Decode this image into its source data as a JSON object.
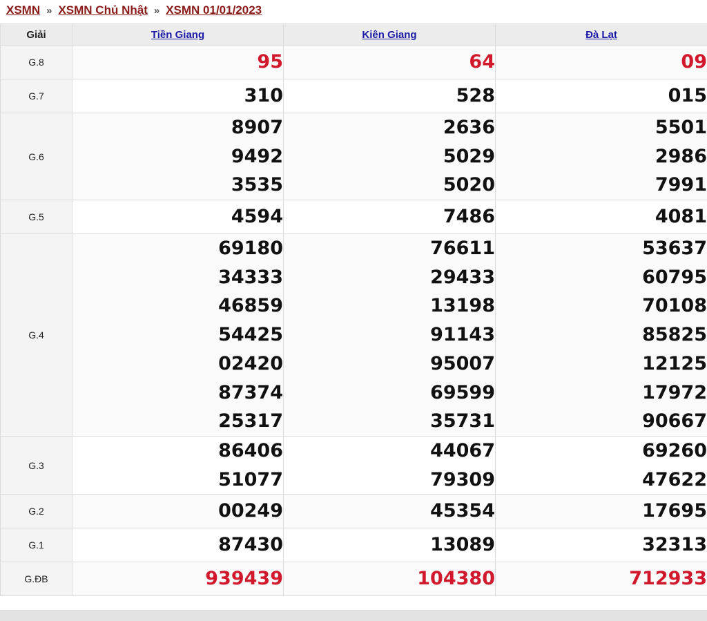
{
  "breadcrumb": {
    "item1": "XSMN",
    "item2": "XSMN Chủ Nhật",
    "item3": "XSMN 01/01/2023",
    "sep": "»"
  },
  "table": {
    "header": {
      "giai": "Giải",
      "col1": "Tiền Giang",
      "col2": "Kiên Giang",
      "col3": "Đà Lạt"
    },
    "rows": [
      {
        "label": "G.8",
        "c1": [
          "95"
        ],
        "c2": [
          "64"
        ],
        "c3": [
          "09"
        ]
      },
      {
        "label": "G.7",
        "c1": [
          "310"
        ],
        "c2": [
          "528"
        ],
        "c3": [
          "015"
        ]
      },
      {
        "label": "G.6",
        "c1": [
          "8907",
          "9492",
          "3535"
        ],
        "c2": [
          "2636",
          "5029",
          "5020"
        ],
        "c3": [
          "5501",
          "2986",
          "7991"
        ]
      },
      {
        "label": "G.5",
        "c1": [
          "4594"
        ],
        "c2": [
          "7486"
        ],
        "c3": [
          "4081"
        ]
      },
      {
        "label": "G.4",
        "c1": [
          "69180",
          "34333",
          "46859",
          "54425",
          "02420",
          "87374",
          "25317"
        ],
        "c2": [
          "76611",
          "29433",
          "13198",
          "91143",
          "95007",
          "69599",
          "35731"
        ],
        "c3": [
          "53637",
          "60795",
          "70108",
          "85825",
          "12125",
          "17972",
          "90667"
        ]
      },
      {
        "label": "G.3",
        "c1": [
          "86406",
          "51077"
        ],
        "c2": [
          "44067",
          "79309"
        ],
        "c3": [
          "69260",
          "47622"
        ]
      },
      {
        "label": "G.2",
        "c1": [
          "00249"
        ],
        "c2": [
          "45354"
        ],
        "c3": [
          "17695"
        ]
      },
      {
        "label": "G.1",
        "c1": [
          "87430"
        ],
        "c2": [
          "13089"
        ],
        "c3": [
          "32313"
        ]
      },
      {
        "label": "G.ĐB",
        "c1": [
          "939439"
        ],
        "c2": [
          "104380"
        ],
        "c3": [
          "712933"
        ]
      }
    ]
  },
  "colors": {
    "highlight": "#d0192c",
    "link": "#1a1aa6",
    "breadcrumb": "#8b1a1a"
  }
}
